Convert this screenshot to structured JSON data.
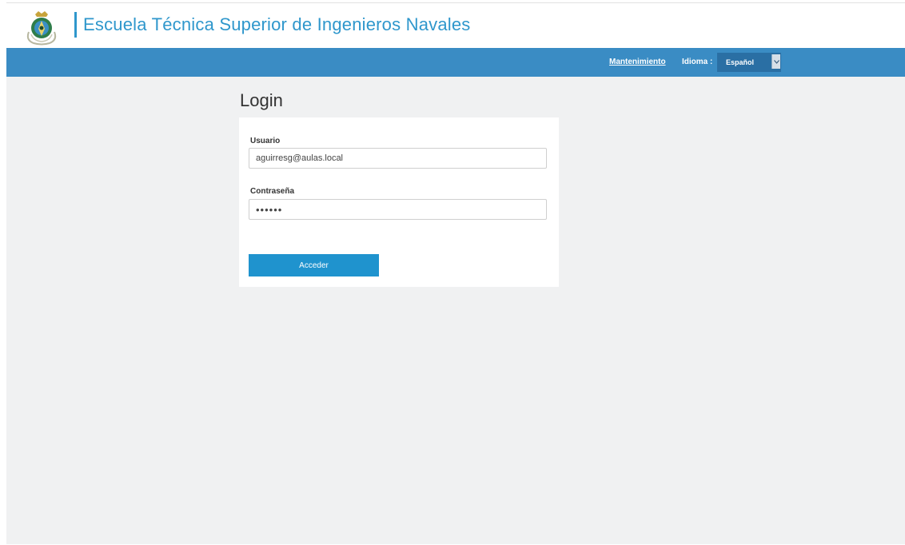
{
  "header": {
    "title": "Escuela Técnica Superior de Ingenieros Navales",
    "logo_icon": "school-crest-icon"
  },
  "navbar": {
    "maintenance_link": "Mantenimiento",
    "language_label": "Idioma :",
    "language_value": "Español",
    "language_arrow_icon": "chevron-down-icon"
  },
  "login": {
    "title": "Login",
    "username_label": "Usuario",
    "username_value": "aguirresg@aulas.local",
    "password_label": "Contraseña",
    "password_value": "••••••",
    "submit_label": "Acceder"
  },
  "colors": {
    "brand_blue": "#2f97cc",
    "navbar": "#3a8cc4",
    "button": "#1f93ce",
    "background": "#f0f1f2"
  }
}
